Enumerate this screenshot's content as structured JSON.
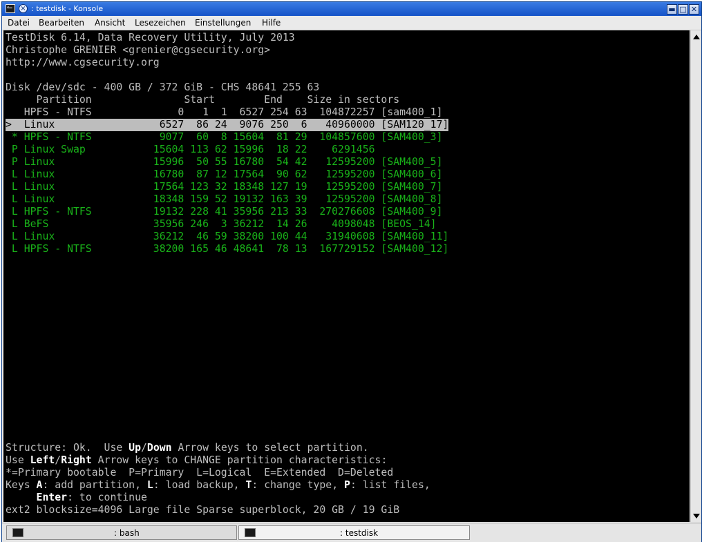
{
  "window": {
    "title": ": testdisk - Konsole",
    "pin_icon": "×",
    "minimize_glyph": "▬",
    "maximize_glyph": "□",
    "close_glyph": "✕"
  },
  "menu": [
    "Datei",
    "Bearbeiten",
    "Ansicht",
    "Lesezeichen",
    "Einstellungen",
    "Hilfe"
  ],
  "terminal": {
    "header": [
      "TestDisk 6.14, Data Recovery Utility, July 2013",
      "Christophe GRENIER <grenier@cgsecurity.org>",
      "http://www.cgsecurity.org"
    ],
    "disk_line": "Disk /dev/sdc - 400 GB / 372 GiB - CHS 48641 255 63",
    "column_header": "     Partition               Start        End    Size in sectors",
    "partitions": [
      {
        "text": "   HPFS - NTFS              0   1  1  6527 254 63  104872257 [sam400_1]",
        "state": "normal"
      },
      {
        "text": ">  Linux                 6527  86 24  9076 250  6   40960000 [SAM120_17]",
        "state": "selected"
      },
      {
        "text": " * HPFS - NTFS           9077  60  8 15604  81 29  104857600 [SAM400_3]",
        "state": "green"
      },
      {
        "text": " P Linux Swap           15604 113 62 15996  18 22    6291456",
        "state": "green"
      },
      {
        "text": " P Linux                15996  50 55 16780  54 42   12595200 [SAM400_5]",
        "state": "green"
      },
      {
        "text": " L Linux                16780  87 12 17564  90 62   12595200 [SAM400_6]",
        "state": "green"
      },
      {
        "text": " L Linux                17564 123 32 18348 127 19   12595200 [SAM400_7]",
        "state": "green"
      },
      {
        "text": " L Linux                18348 159 52 19132 163 39   12595200 [SAM400_8]",
        "state": "green"
      },
      {
        "text": " L HPFS - NTFS          19132 228 41 35956 213 33  270276608 [SAM400_9]",
        "state": "green"
      },
      {
        "text": " L BeFS                 35956 246  3 36212  14 26    4098048 [BEOS_14]",
        "state": "green"
      },
      {
        "text": " L Linux                36212  46 59 38200 100 44   31940608 [SAM400_11]",
        "state": "green"
      },
      {
        "text": " L HPFS - NTFS          38200 165 46 48641  78 13  167729152 [SAM400_12]",
        "state": "green"
      }
    ],
    "footer": {
      "l1": {
        "a": "Structure: Ok.  Use ",
        "b": "Up",
        "c": "/",
        "d": "Down",
        "e": " Arrow keys to select partition."
      },
      "l2": {
        "a": "Use ",
        "b": "Left",
        "c": "/",
        "d": "Right",
        "e": " Arrow keys to CHANGE partition characteristics:"
      },
      "l3": "*=Primary bootable  P=Primary  L=Logical  E=Extended  D=Deleted",
      "l4": {
        "a": "Keys ",
        "b": "A",
        "c": ": add partition, ",
        "d": "L",
        "e": ": load backup, ",
        "f": "T",
        "g": ": change type, ",
        "h": "P",
        "i": ": list files,"
      },
      "l5": {
        "a": "     ",
        "b": "Enter",
        "c": ": to continue"
      },
      "l6": "ext2 blocksize=4096 Large file Sparse superblock, 20 GB / 19 GiB"
    }
  },
  "tabs": [
    {
      "label": ": bash",
      "active": false
    },
    {
      "label": ": testdisk",
      "active": true
    }
  ],
  "colors": {
    "terminal_bg": "#000000",
    "text": "#bdbdbd",
    "green": "#19b219",
    "titlebar": "#1553c8"
  }
}
